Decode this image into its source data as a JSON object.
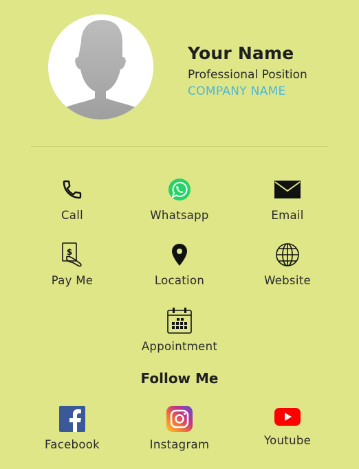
{
  "profile": {
    "name": "Your Name",
    "position": "Professional Position",
    "company": "COMPANY NAME"
  },
  "actions": [
    {
      "label": "Call",
      "icon": "phone-icon"
    },
    {
      "label": "Whatsapp",
      "icon": "whatsapp-icon"
    },
    {
      "label": "Email",
      "icon": "envelope-icon"
    },
    {
      "label": "Pay Me",
      "icon": "money-hand-icon"
    },
    {
      "label": "Location",
      "icon": "map-pin-icon"
    },
    {
      "label": "Website",
      "icon": "globe-icon"
    },
    {
      "label": "Appointment",
      "icon": "calendar-icon"
    }
  ],
  "follow": {
    "title": "Follow Me",
    "items": [
      {
        "label": "Facebook",
        "icon": "facebook-icon"
      },
      {
        "label": "Instagram",
        "icon": "instagram-icon"
      },
      {
        "label": "Youtube",
        "icon": "youtube-icon"
      }
    ]
  },
  "colors": {
    "background": "#dee688",
    "company_text": "#4fb6d9",
    "whatsapp": "#25d366",
    "facebook": "#3b5998",
    "youtube": "#ff0000"
  }
}
